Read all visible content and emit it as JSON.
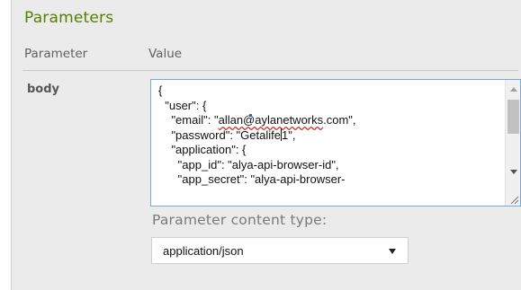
{
  "section": {
    "title": "Parameters"
  },
  "table": {
    "headers": {
      "parameter": "Parameter",
      "value": "Value"
    },
    "row": {
      "name": "body"
    }
  },
  "body_editor": {
    "lines": [
      "{",
      "  \"user\": {",
      "    \"email\": \"",
      "allan@aylanetworks",
      ".com\",",
      "    \"password\": \"Getalife",
      "1\",",
      "    \"application\": {",
      "      \"app_id\": \"alya-api-browser-id\",",
      "      \"app_secret\": \"alya-api-browser-"
    ]
  },
  "content_type": {
    "label": "Parameter content type:",
    "selected": "application/json"
  },
  "colors": {
    "title_green": "#547f00",
    "panel_bg": "#ebebeb",
    "focus_border": "#7aa7d6",
    "spellcheck_red": "#d0312d"
  },
  "icons": [
    "scroll-up-arrow-icon",
    "scroll-down-arrow-icon",
    "resize-grip-icon",
    "dropdown-arrow-icon"
  ]
}
